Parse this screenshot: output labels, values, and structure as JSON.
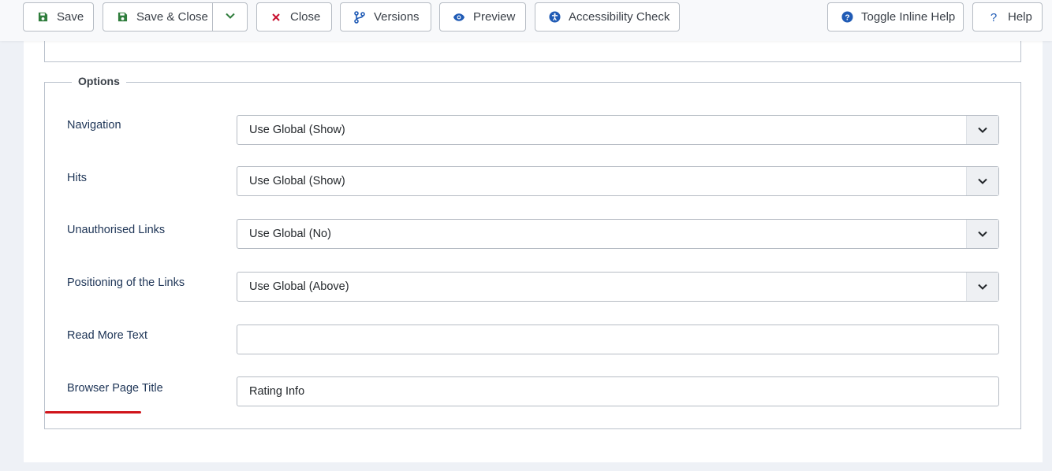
{
  "toolbar": {
    "save": "Save",
    "save_close": "Save & Close",
    "close": "Close",
    "versions": "Versions",
    "preview": "Preview",
    "accessibility": "Accessibility Check",
    "toggle_help": "Toggle Inline Help",
    "help": "Help"
  },
  "colors": {
    "save_icon": "#2f7d3c",
    "close_icon": "#c8102e",
    "blue_icon": "#205bb5",
    "underline": "#d0141a"
  },
  "options": {
    "legend": "Options",
    "fields": [
      {
        "label": "Navigation",
        "value": "Use Global (Show)",
        "type": "select"
      },
      {
        "label": "Hits",
        "value": "Use Global (Show)",
        "type": "select"
      },
      {
        "label": "Unauthorised Links",
        "value": "Use Global (No)",
        "type": "select"
      },
      {
        "label": "Positioning of the Links",
        "value": "Use Global (Above)",
        "type": "select"
      },
      {
        "label": "Read More Text",
        "value": "",
        "type": "text"
      },
      {
        "label": "Browser Page Title",
        "value": "Rating Info",
        "type": "text"
      }
    ]
  }
}
